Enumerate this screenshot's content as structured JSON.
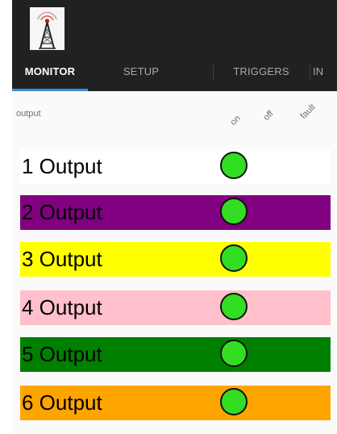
{
  "header": {
    "logo_icon": "radio-tower-icon",
    "tabs": [
      {
        "label": "MONITOR",
        "active": true
      },
      {
        "label": "SETUP",
        "active": false
      },
      {
        "label": "TRIGGERS",
        "active": false
      },
      {
        "label": "IN",
        "active": false
      }
    ],
    "accent_color": "#3d8ed3"
  },
  "table": {
    "output_label": "output",
    "columns": [
      "on",
      "off",
      "fault"
    ]
  },
  "outputs": [
    {
      "label": "1 Output",
      "color": "#ffffff",
      "state": "on",
      "indicator_color": "#33dd22"
    },
    {
      "label": "2 Output",
      "color": "#800080",
      "state": "on",
      "indicator_color": "#33dd22"
    },
    {
      "label": "3 Output",
      "color": "#ffff00",
      "state": "on",
      "indicator_color": "#33dd22"
    },
    {
      "label": "4 Output",
      "color": "#ffc0cb",
      "state": "on",
      "indicator_color": "#33dd22"
    },
    {
      "label": "5 Output",
      "color": "#008000",
      "state": "on",
      "indicator_color": "#33dd22"
    },
    {
      "label": "6 Output",
      "color": "#ffa500",
      "state": "on",
      "indicator_color": "#33dd22"
    }
  ]
}
